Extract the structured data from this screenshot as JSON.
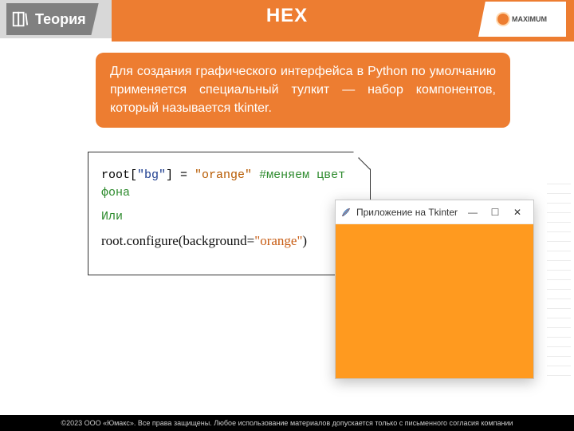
{
  "header": {
    "tab_label": "Теория",
    "title": "HEX",
    "logo_text": "MAXIMUM"
  },
  "intro": {
    "text": "Для создания графического интерфейса в Python по умолчанию применяется специальный тулкит — набор компонентов, который называется tkinter."
  },
  "code": {
    "line1_pre": "root[",
    "line1_key": "\"bg\"",
    "line1_mid": "] = ",
    "line1_val": "\"orange\"",
    "line1_cmt": " #меняем цвет фона",
    "or_label": "Или",
    "line2_pre": "root.configure(background=",
    "line2_arg": "\"orange\"",
    "line2_post": ")"
  },
  "tk_window": {
    "title": "Приложение на Tkinter",
    "min_btn": "—",
    "max_btn": "☐",
    "close_btn": "✕",
    "bg_color": "#ff9a1f"
  },
  "footer": {
    "text": "©2023 ООО «Юмакс». Все права защищены. Любое использование материалов допускается только с письменного согласия компании"
  }
}
